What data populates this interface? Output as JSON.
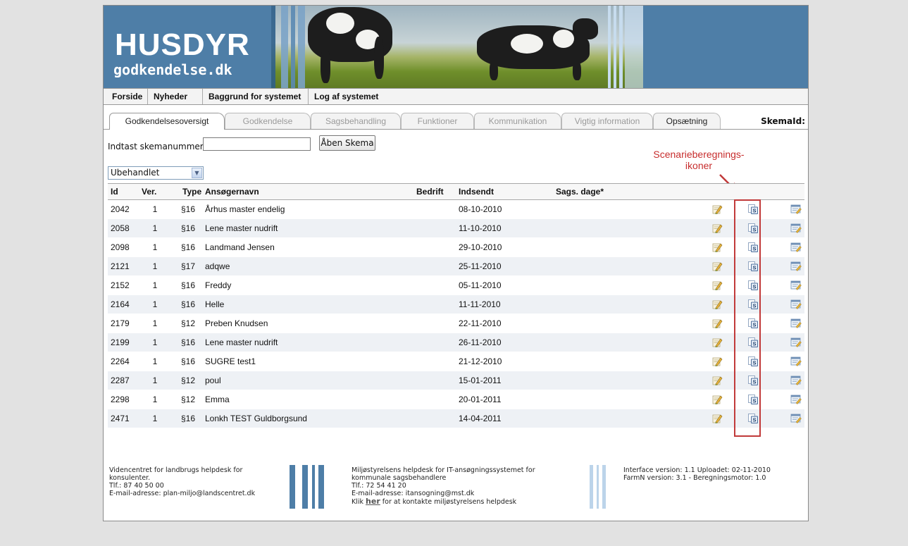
{
  "brand": {
    "title": "HUSDYR",
    "subtitle": "godkendelse.dk"
  },
  "nav": [
    {
      "label": "Forside"
    },
    {
      "label": "Nyheder"
    },
    {
      "label": "Baggrund for systemet"
    },
    {
      "label": "Log af systemet"
    }
  ],
  "tabs": [
    {
      "label": "Godkendelsesoversigt",
      "state": "active"
    },
    {
      "label": "Godkendelse",
      "state": "disabled"
    },
    {
      "label": "Sagsbehandling",
      "state": "disabled"
    },
    {
      "label": "Funktioner",
      "state": "disabled"
    },
    {
      "label": "Kommunikation",
      "state": "disabled"
    },
    {
      "label": "Vigtig information",
      "state": "disabled"
    },
    {
      "label": "Opsætning",
      "state": "enabled"
    }
  ],
  "skema_id_label": "SkemaId:",
  "search": {
    "label": "Indtast skemanummer:",
    "value": "",
    "button": "Åben Skema"
  },
  "status_filter": {
    "selected": "Ubehandlet"
  },
  "annotation": {
    "line1": "Scenarieberegnings-",
    "line2": "ikoner",
    "color": "#c72d2d"
  },
  "table": {
    "columns": [
      "Id",
      "Ver.",
      "Type",
      "Ansøgernavn",
      "Bedrift",
      "Indsendt",
      "Sags. dage*"
    ],
    "rows": [
      {
        "id": "2042",
        "ver": "1",
        "type": "§16",
        "name": "Århus master endelig",
        "bedrift": "",
        "indsendt": "08-10-2010",
        "dage": ""
      },
      {
        "id": "2058",
        "ver": "1",
        "type": "§16",
        "name": "Lene master nudrift",
        "bedrift": "",
        "indsendt": "11-10-2010",
        "dage": ""
      },
      {
        "id": "2098",
        "ver": "1",
        "type": "§16",
        "name": "Landmand Jensen",
        "bedrift": "",
        "indsendt": "29-10-2010",
        "dage": ""
      },
      {
        "id": "2121",
        "ver": "1",
        "type": "§17",
        "name": "adqwe",
        "bedrift": "",
        "indsendt": "25-11-2010",
        "dage": ""
      },
      {
        "id": "2152",
        "ver": "1",
        "type": "§16",
        "name": "Freddy",
        "bedrift": "",
        "indsendt": "05-11-2010",
        "dage": ""
      },
      {
        "id": "2164",
        "ver": "1",
        "type": "§16",
        "name": "Helle",
        "bedrift": "",
        "indsendt": "11-11-2010",
        "dage": ""
      },
      {
        "id": "2179",
        "ver": "1",
        "type": "§12",
        "name": "Preben Knudsen",
        "bedrift": "",
        "indsendt": "22-11-2010",
        "dage": ""
      },
      {
        "id": "2199",
        "ver": "1",
        "type": "§16",
        "name": "Lene master nudrift",
        "bedrift": "",
        "indsendt": "26-11-2010",
        "dage": ""
      },
      {
        "id": "2264",
        "ver": "1",
        "type": "§16",
        "name": "SUGRE test1",
        "bedrift": "",
        "indsendt": "21-12-2010",
        "dage": ""
      },
      {
        "id": "2287",
        "ver": "1",
        "type": "§12",
        "name": "poul",
        "bedrift": "",
        "indsendt": "15-01-2011",
        "dage": ""
      },
      {
        "id": "2298",
        "ver": "1",
        "type": "§12",
        "name": "Emma",
        "bedrift": "",
        "indsendt": "20-01-2011",
        "dage": ""
      },
      {
        "id": "2471",
        "ver": "1",
        "type": "§16",
        "name": "Lonkh TEST Guldborgsund",
        "bedrift": "",
        "indsendt": "14-04-2011",
        "dage": ""
      }
    ],
    "row_icons": [
      "edit-pencil-icon",
      "scenario-s-icon",
      "document-pencil-icon"
    ]
  },
  "footer": {
    "left": {
      "line1": "Videncentret for landbrugs helpdesk for",
      "line2": "konsulenter.",
      "line3": "Tlf.: 87 40 50 00",
      "line4": "E-mail-adresse: plan-miljo@landscentret.dk"
    },
    "middle": {
      "line1": "Miljøstyrelsens helpdesk for IT-ansøgningssystemet for",
      "line2": "kommunale sagsbehandlere",
      "line3": "Tlf.: 72 54 41 20",
      "line4": "E-mail-adresse: itansogning@mst.dk",
      "link_prefix": "Klik",
      "link_text": "her",
      "link_suffix": "for at kontakte miljøstyrelsens helpdesk"
    },
    "right": {
      "line1": "Interface version: 1.1 Uploadet: 02-11-2010",
      "line2": "FarmN version: 3.1 - Beregningsmotor: 1.0"
    }
  },
  "colors": {
    "banner": "#4e7ea7",
    "annotation": "#c72d2d",
    "row_alt": "#eef1f5"
  }
}
